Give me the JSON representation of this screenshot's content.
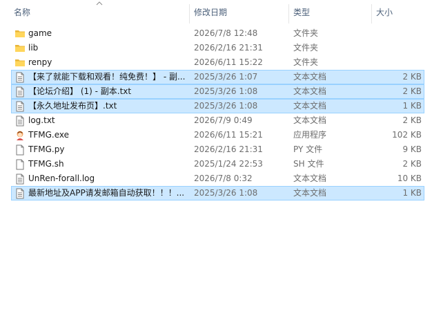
{
  "columns": {
    "name": "名称",
    "date": "修改日期",
    "type": "类型",
    "size": "大小"
  },
  "files": [
    {
      "name": "game",
      "date": "2026/7/8 12:48",
      "type": "文件夹",
      "size": "",
      "icon": "folder-icon",
      "selected": false
    },
    {
      "name": "lib",
      "date": "2026/2/16 21:31",
      "type": "文件夹",
      "size": "",
      "icon": "folder-icon",
      "selected": false
    },
    {
      "name": "renpy",
      "date": "2026/6/11 15:22",
      "type": "文件夹",
      "size": "",
      "icon": "folder-icon",
      "selected": false
    },
    {
      "name": "【来了就能下载和观看！纯免费！】 - 副...",
      "date": "2025/3/26 1:07",
      "type": "文本文档",
      "size": "2 KB",
      "icon": "text-document-icon",
      "selected": true
    },
    {
      "name": "【论坛介绍】 (1) - 副本.txt",
      "date": "2025/3/26 1:08",
      "type": "文本文档",
      "size": "2 KB",
      "icon": "text-document-icon",
      "selected": true
    },
    {
      "name": "【永久地址发布页】.txt",
      "date": "2025/3/26 1:08",
      "type": "文本文档",
      "size": "1 KB",
      "icon": "text-document-icon",
      "selected": true
    },
    {
      "name": "log.txt",
      "date": "2026/7/9 0:49",
      "type": "文本文档",
      "size": "2 KB",
      "icon": "text-document-icon",
      "selected": false
    },
    {
      "name": "TFMG.exe",
      "date": "2026/6/11 15:21",
      "type": "应用程序",
      "size": "102 KB",
      "icon": "application-icon",
      "selected": false
    },
    {
      "name": "TFMG.py",
      "date": "2026/2/16 21:31",
      "type": "PY 文件",
      "size": "9 KB",
      "icon": "blank-file-icon",
      "selected": false
    },
    {
      "name": "TFMG.sh",
      "date": "2025/1/24 22:53",
      "type": "SH 文件",
      "size": "2 KB",
      "icon": "blank-file-icon",
      "selected": false
    },
    {
      "name": "UnRen-forall.log",
      "date": "2026/7/8 0:32",
      "type": "文本文档",
      "size": "10 KB",
      "icon": "text-document-icon",
      "selected": false
    },
    {
      "name": "最新地址及APP请发邮箱自动获取！！！...",
      "date": "2025/3/26 1:08",
      "type": "文本文档",
      "size": "1 KB",
      "icon": "text-document-icon",
      "selected": true
    }
  ],
  "colors": {
    "selection_bg": "#cce8ff",
    "selection_border": "#99d1ff",
    "folder": "#ffd65c",
    "folder_tab": "#e8b539"
  }
}
